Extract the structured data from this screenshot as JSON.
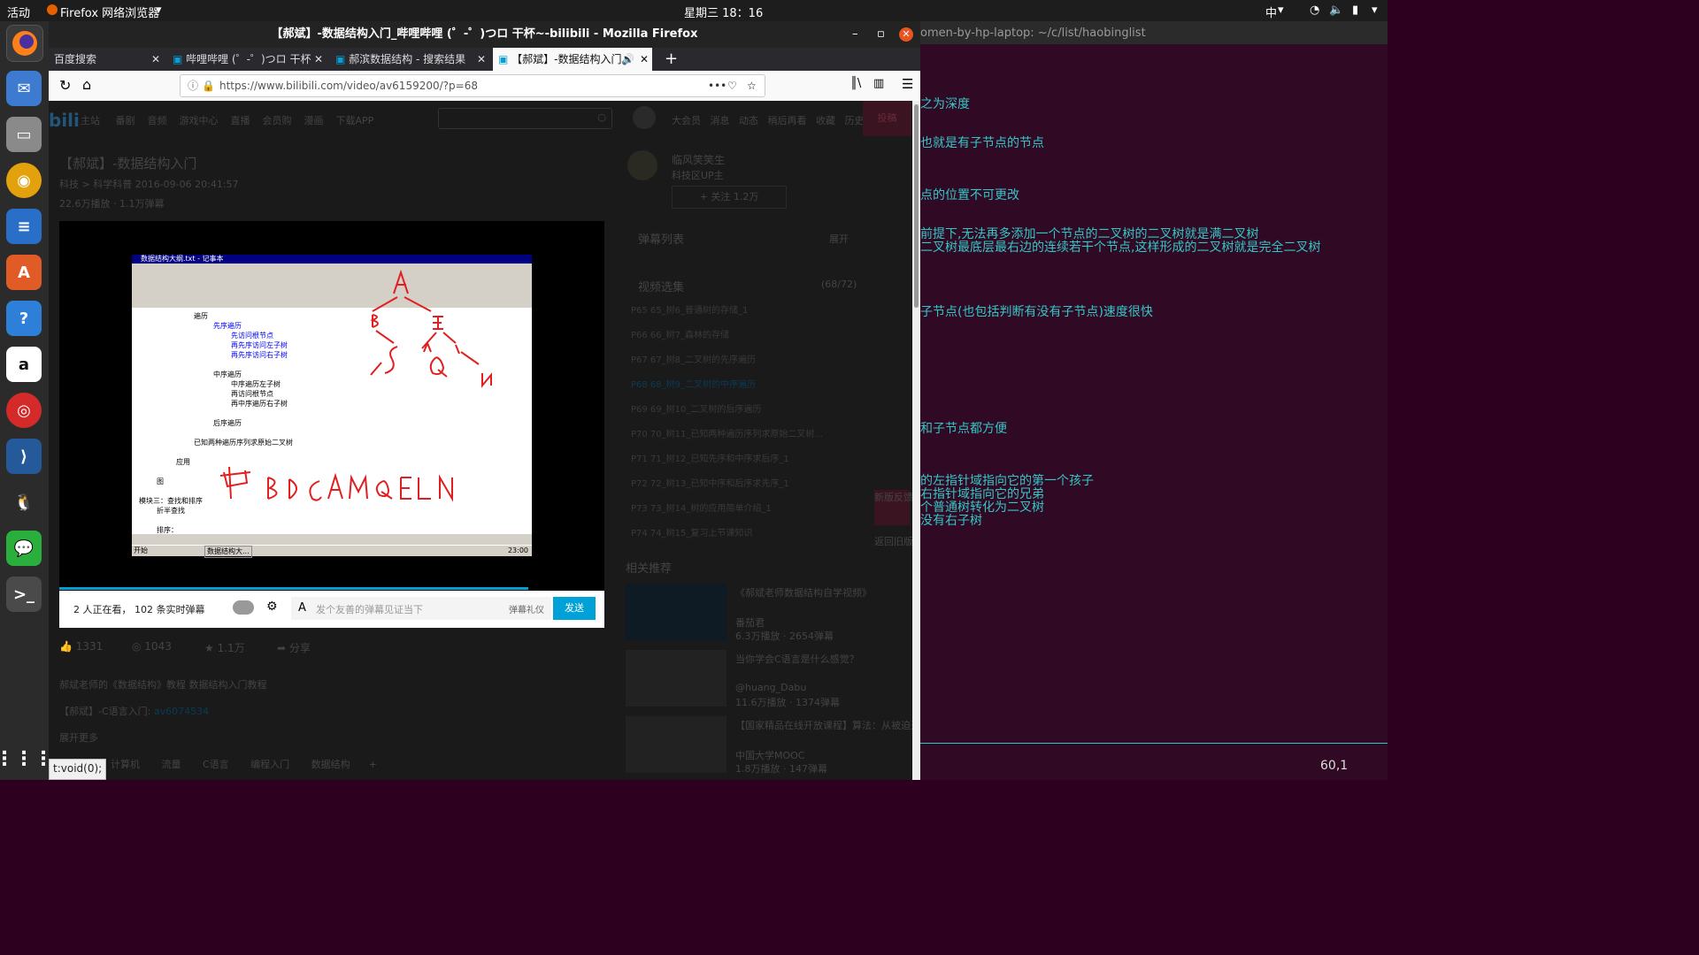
{
  "topbar": {
    "activities": "活动",
    "app_menu": "Firefox 网络浏览器",
    "clock": "星期三 18：16",
    "input_method": "中"
  },
  "firefox": {
    "window_title": "【郝斌】-数据结构入门_哔哩哔哩 (゜-゜)つロ 干杯~-bilibili - Mozilla Firefox",
    "tabs": [
      {
        "label": "百度搜索"
      },
      {
        "label": "哔哩哔哩 (゜-゜)つロ 干杯"
      },
      {
        "label": "郝滨数据结构 - 搜索结果"
      },
      {
        "label": "【郝斌】-数据结构入门"
      }
    ],
    "url": "https://www.bilibili.com/video/av6159200/?p=68",
    "status_text": "t:void(0);"
  },
  "bilibili": {
    "nav": [
      "主站",
      "番剧",
      "音频",
      "游戏中心",
      "直播",
      "会员购",
      "漫画",
      "下载APP"
    ],
    "user_nav": [
      "大会员",
      "消息",
      "动态",
      "稍后再看",
      "收藏",
      "历史"
    ],
    "upload": "投稿",
    "video_title": "【郝斌】-数据结构入门",
    "meta": "科技 > 科学科普    2016-09-06 20:41:57",
    "views": "22.6万播放 · 1.1万弹幕",
    "uploader": "临风笑笑生",
    "uploader_sub": "科技区UP主",
    "follow": "+ 关注 1.2万",
    "danmaku_list": "弹幕列表",
    "expand": "展开",
    "episodes_title": "视频选集",
    "episodes_count": "(68/72)",
    "episodes": [
      "P65  65_树6_普通树的存储_1",
      "P66  66_树7_森林的存储",
      "P67  67_树8_二叉树的先序遍历",
      "P68  68_树9_二叉树的中序遍历",
      "P69  69_树10_二叉树的后序遍历",
      "P70  70_树11_已知两种遍历序列求原始二叉树...",
      "P71  71_树12_已知先序和中序求后序_1",
      "P72  72_树13_已知中序和后序求先序_1",
      "P73  73_树14_树的应用简单介绍_1",
      "P74  74_树15_复习上节课知识"
    ],
    "related_title": "相关推荐",
    "related": [
      {
        "title": "《郝斌老师数据结构自学视频》",
        "author": "番茄君",
        "stats": "6.3万播放 · 2654弹幕"
      },
      {
        "title": "当你学会C语言是什么感觉？",
        "author": "@huang_Dabu",
        "stats": "11.6万播放 · 1374弹幕"
      },
      {
        "title": "【国家精品在线开放课程】算法：从被迫开MOOC，到",
        "author": "中国大学MOOC",
        "stats": "1.8万播放 · 147弹幕"
      }
    ],
    "watching": "2 人正在看， 102 条实时弹幕",
    "danmaku_placeholder": "发个友善的弹幕见证当下",
    "danmaku_etiquette": "弹幕礼仪",
    "send": "发送",
    "likes": "1331",
    "coins": "1043",
    "favorites": "1.1万",
    "share": "分享",
    "description": "郝斌老师的《数据结构》教程 数据结构入门教程",
    "desc_link_label": "【郝斌】-C语言入门:",
    "desc_link": "av6074534",
    "more": "展开更多",
    "tags": [
      "计算机",
      "流量",
      "C语言",
      "编程入门",
      "数据结构"
    ],
    "side_buttons": [
      "新版反馈",
      "返回旧版"
    ]
  },
  "video": {
    "notepad_title": "数据结构大纲.txt - 记事本",
    "lines": [
      {
        "text": "遍历",
        "color": "#000"
      },
      {
        "text": "先序遍历",
        "color": "#0000ee"
      },
      {
        "text": "先访问根节点",
        "color": "#0000ee"
      },
      {
        "text": "再先序访问左子树",
        "color": "#0000ee"
      },
      {
        "text": "再先序访问右子树",
        "color": "#0000ee"
      },
      {
        "text": "中序遍历",
        "color": "#000"
      },
      {
        "text": "中序遍历左子树",
        "color": "#000"
      },
      {
        "text": "再访问根节点",
        "color": "#000"
      },
      {
        "text": "再中序遍历右子树",
        "color": "#000"
      },
      {
        "text": "后序遍历",
        "color": "#000"
      },
      {
        "text": "已知两种遍历序列求原始二叉树",
        "color": "#000"
      },
      {
        "text": "应用",
        "color": "#000"
      },
      {
        "text": "图",
        "color": "#000"
      },
      {
        "text": "模块三：查找和排序",
        "color": "#000"
      },
      {
        "text": "折半查找",
        "color": "#000"
      },
      {
        "text": "排序：",
        "color": "#000"
      }
    ],
    "taskbar_start": "开始",
    "taskbar_item": "数据结构大...",
    "taskbar_time": "23:00",
    "handwriting_color": "#e02020"
  },
  "terminal": {
    "title": "omen-by-hp-laptop: ~/c/list/haobinglist",
    "lines": [
      "之为深度",
      "也就是有子节点的节点",
      "点的位置不可更改",
      "前提下,无法再多添加一个节点的二叉树的二叉树就是满二叉树",
      "二叉树最底层最右边的连续若干个节点,这样形成的二叉树就是完全二叉树",
      "子节点(也包括判断有没有子节点)速度很快",
      "和子节点都方便",
      "的左指针域指向它的第一个孩子",
      "    右指针域指向它的兄弟",
      "个普通树转化为二叉树",
      "没有右子树"
    ],
    "cursor_pos": "60,1"
  }
}
